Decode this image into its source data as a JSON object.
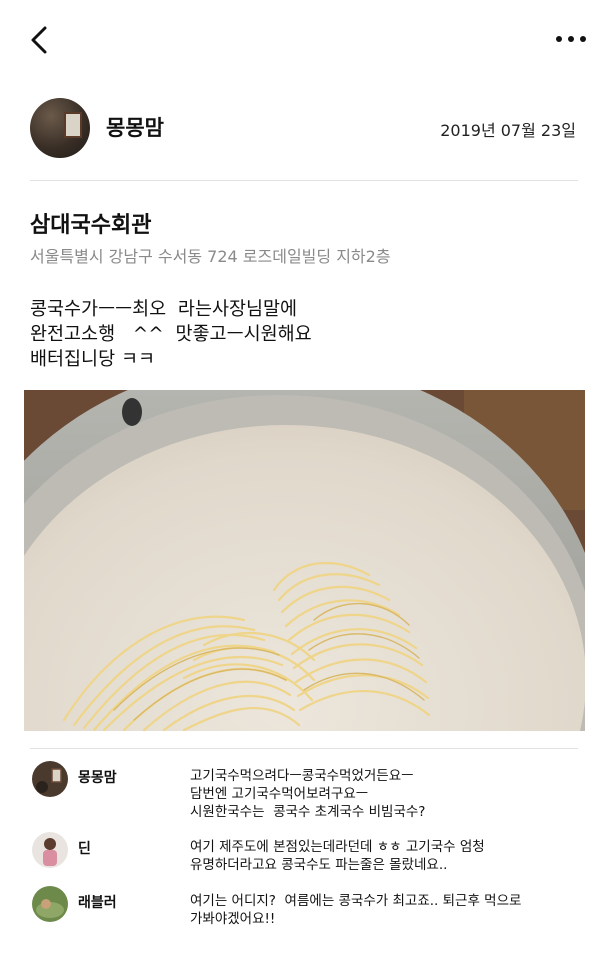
{
  "header": {
    "back_icon": "chevron-left-icon",
    "more_icon": "more-horizontal-icon"
  },
  "post": {
    "author": "몽몽맘",
    "date": "2019년 07월 23일",
    "place_name": "삼대국수회관",
    "place_address": "서울특별시 강남구 수서동 724 로즈데일빌딩 지하2층",
    "body_lines": [
      "콩국수가ㅡㅡ최오  라는사장님말에",
      "완전고소행   ^^  맛좋고ㅡ시원해요",
      "배터집니당 ㅋㅋ"
    ]
  },
  "comments": [
    {
      "author": "몽몽맘",
      "lines": [
        "고기국수먹으려다ㅡ콩국수먹었거든요ㅡ",
        "담번엔 고기국수먹어보려구요ㅡ",
        "시원한국수는  콩국수 초계국수 비빔국수?"
      ]
    },
    {
      "author": "딘",
      "lines": [
        "여기 제주도에 본점있는데라던데 ㅎㅎ 고기국수 엄청",
        "유명하더라고요 콩국수도 파는줄은 몰랐네요.."
      ]
    },
    {
      "author": "래블러",
      "lines": [
        "여기는 어디지?  여름에는 콩국수가 최고죠.. 퇴근후 먹으로",
        "가봐야겠어요!!"
      ]
    }
  ],
  "colors": {
    "text": "#111111",
    "muted": "#8a8a8a",
    "divider": "#e2e2e2"
  }
}
